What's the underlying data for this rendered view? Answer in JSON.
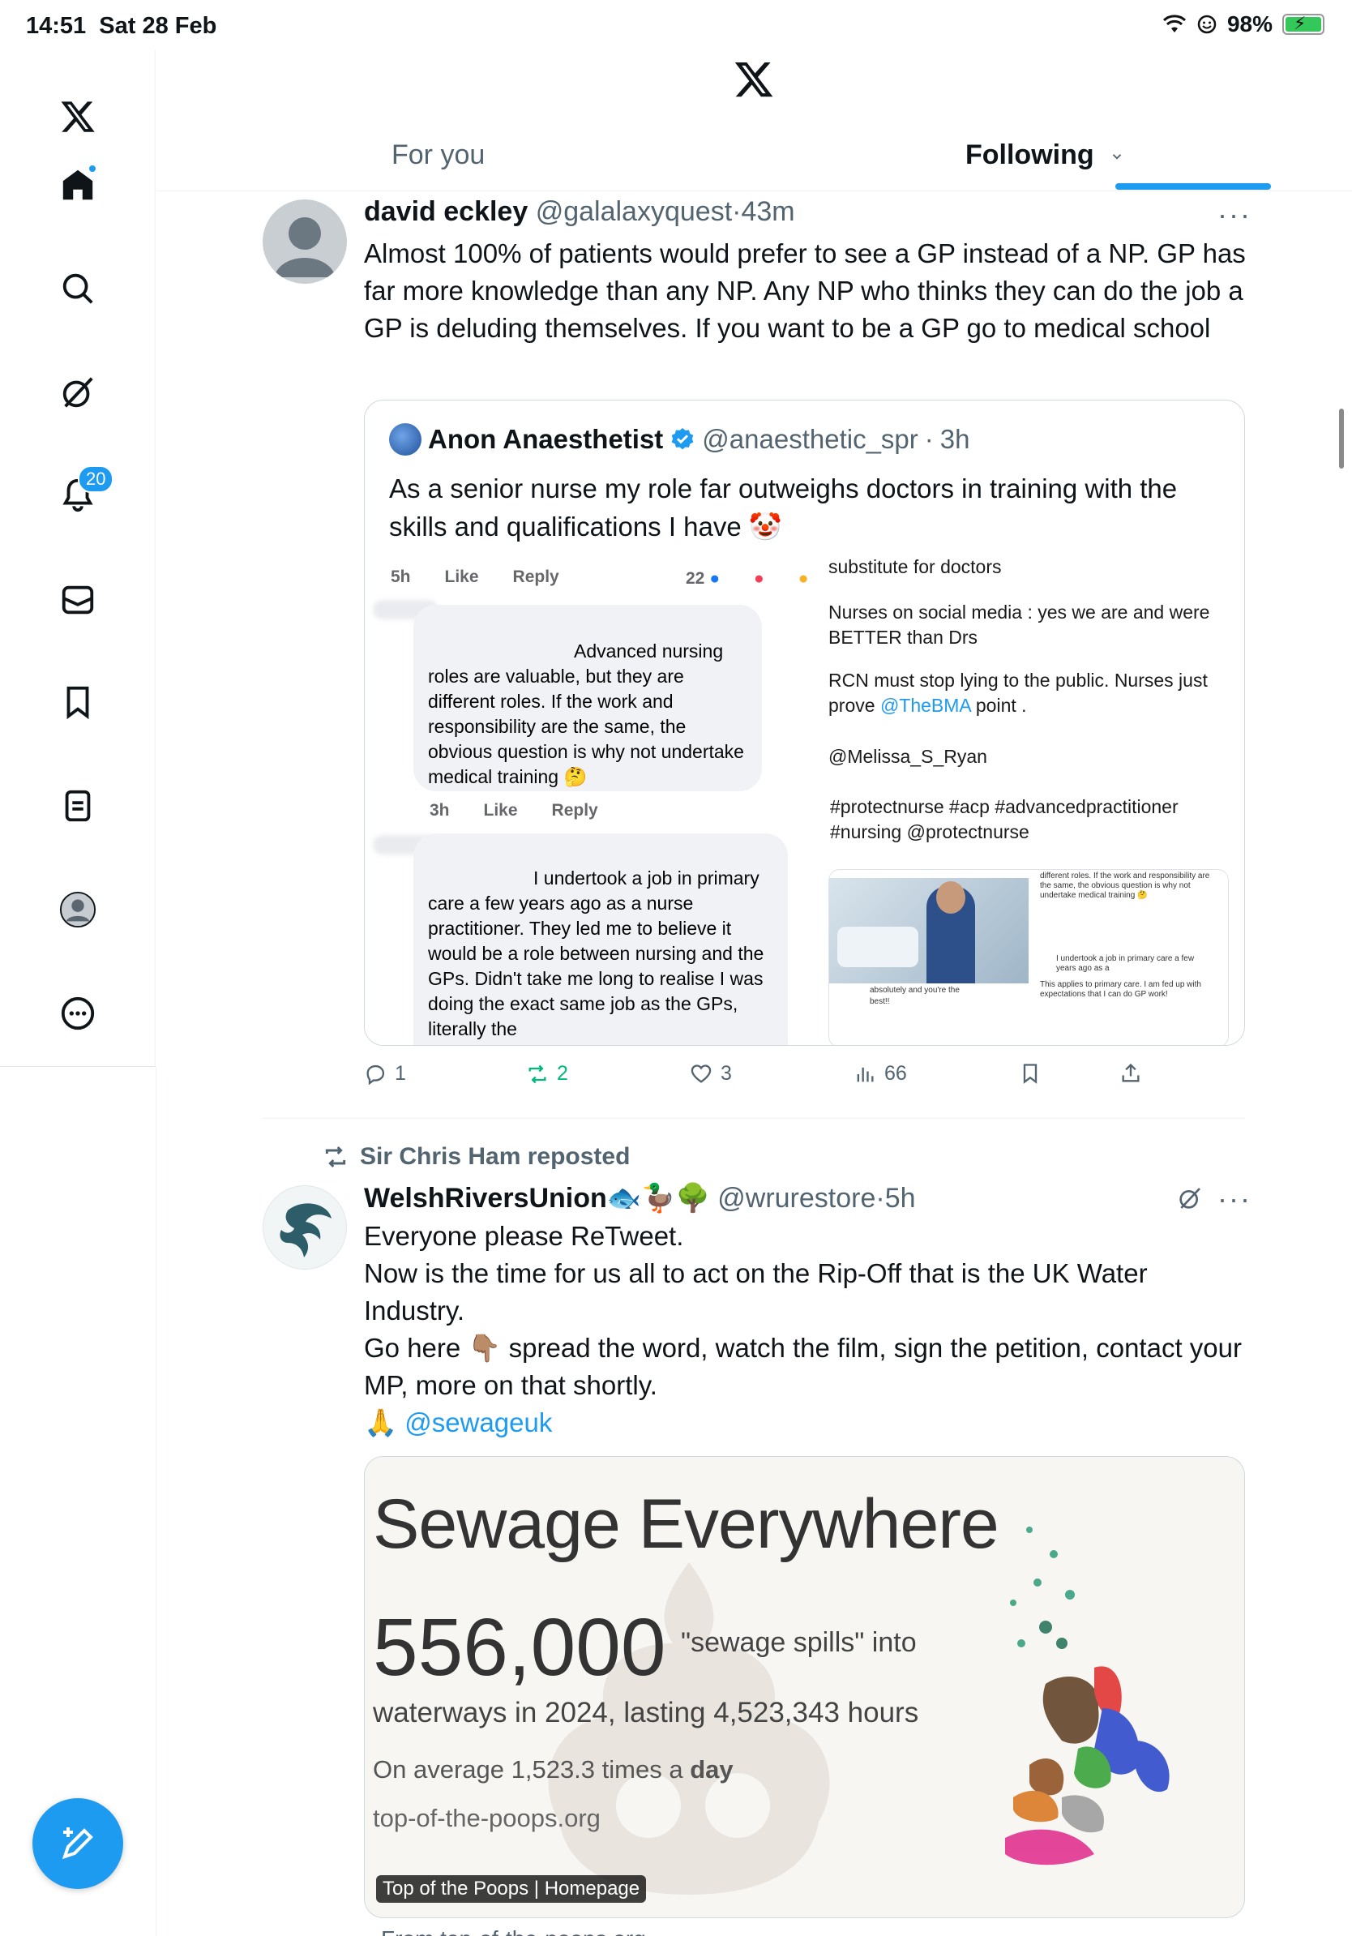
{
  "status": {
    "time": "14:51",
    "date": "Sat 28 Feb",
    "battery": "98%"
  },
  "sidebar": {
    "notifications_count": "20"
  },
  "tabs": {
    "for_you": "For you",
    "following": "Following"
  },
  "post1": {
    "name": "david eckley",
    "handle": "@galalaxyquest",
    "time": "43m",
    "text": "Almost 100% of patients would prefer to see a GP instead of a NP. GP has far more knowledge than any NP. Any NP who thinks they can do the job a GP is deluding themselves. If you want to be a GP go to medical school",
    "quote": {
      "name": "Anon Anaesthetist",
      "handle": "@anaesthetic_spr",
      "time": "3h",
      "text": "As a senior nurse my role far outweighs doctors in training with the skills and qualifications I have 🤡",
      "left_image": {
        "meta1_time": "5h",
        "meta1_like": "Like",
        "meta1_reply": "Reply",
        "meta1_count": "22",
        "comment1": "Advanced nursing roles are valuable, but they are different roles. If the work and responsibility are the same, the obvious question is why not undertake medical training 🤔",
        "meta2_time": "3h",
        "meta2_like": "Like",
        "meta2_reply": "Reply",
        "comment2": "I undertook a job in primary care a few years ago as a nurse practitioner. They led me to believe it would be a role between nursing and the GPs. Didn't take me long to realise I was doing the exact same job as the GPs, literally the"
      },
      "right_image": {
        "line0": "substitute for doctors",
        "line1": "Nurses on social media : yes we are and were BETTER than Drs",
        "line2a": "RCN must stop lying to the public. Nurses just prove ",
        "line2_link": "@TheBMA",
        "line2b": " point .",
        "mention": "@Melissa_S_Ryan",
        "hashtags": "#protectnurse #acp #advancedpractitioner #nursing @protectnurse",
        "thumb_text1": "different roles. If the work and responsibility are the same, the obvious question is why not undertake medical training 🤔",
        "thumb_text2": "I undertook a job in primary care a few years ago as a",
        "thumb_text3": "This applies to primary care. I am fed up with expectations that I can do GP work!",
        "thumb_text4": "absolutely and you're the best!!"
      }
    },
    "actions": {
      "replies": "1",
      "reposts": "2",
      "likes": "3",
      "views": "66"
    }
  },
  "post2": {
    "reposted_by": "Sir Chris Ham reposted",
    "name": "WelshRiversUnion",
    "emojis": "🐟🦆🌳",
    "handle": "@wrurestore",
    "time": "5h",
    "text_lines": [
      "Everyone please ReTweet.",
      "Now is the time for us all to act on the Rip-Off that is the UK Water Industry.",
      "Go here 👇🏽 spread the word, watch the film, sign the petition, contact your MP, more on that shortly."
    ],
    "text_pray": "🙏 ",
    "text_mention": "@sewageuk",
    "media": {
      "title": "Sewage Everywhere",
      "big_number": "556,000",
      "small_text": "\"sewage spills\" into",
      "line2": "waterways in 2024, lasting 4,523,343 hours",
      "line3_a": "On average 1,523.3 times a ",
      "line3_b": "day",
      "line4": "top-of-the-poops.org",
      "label": "Top of the Poops | Homepage"
    },
    "next_fragment": "From top-of-the-poops.org"
  }
}
